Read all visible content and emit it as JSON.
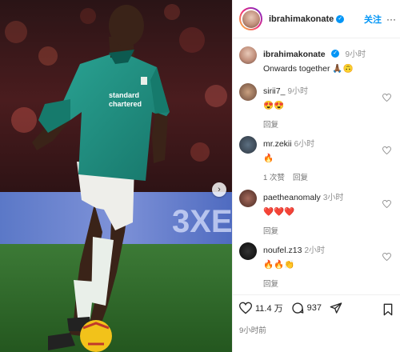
{
  "post": {
    "username": "ibrahimakonate",
    "follow_label": "关注",
    "more_label": "···",
    "caption_user": "ibrahimakonate",
    "caption_time": "9小时",
    "caption_text": "Onwards together 🙏🏾🙃"
  },
  "comments": [
    {
      "user": "sirii7_",
      "time": "9小时",
      "text": "😍😍",
      "actions": [
        "回复"
      ]
    },
    {
      "user": "mr.zekii",
      "time": "6小时",
      "text": "🔥",
      "actions": [
        "1 次赞",
        "回复"
      ]
    },
    {
      "user": "paetheanomaly",
      "time": "3小时",
      "text": "❤️❤️❤️",
      "actions": [
        "回复"
      ]
    },
    {
      "user": "noufel.z13",
      "time": "2小时",
      "text": "🔥🔥👏",
      "actions": [
        "回复"
      ]
    }
  ],
  "actions": {
    "likes": "11.4 万",
    "comments": "937",
    "posted": "9小时前"
  },
  "jersey": {
    "sponsor_line1": "standard",
    "sponsor_line2": "chartered",
    "banner_text": "3XE"
  },
  "colors": {
    "kit": "#1f8a7c",
    "accent": "#0095f6",
    "like": "#ed4956"
  }
}
